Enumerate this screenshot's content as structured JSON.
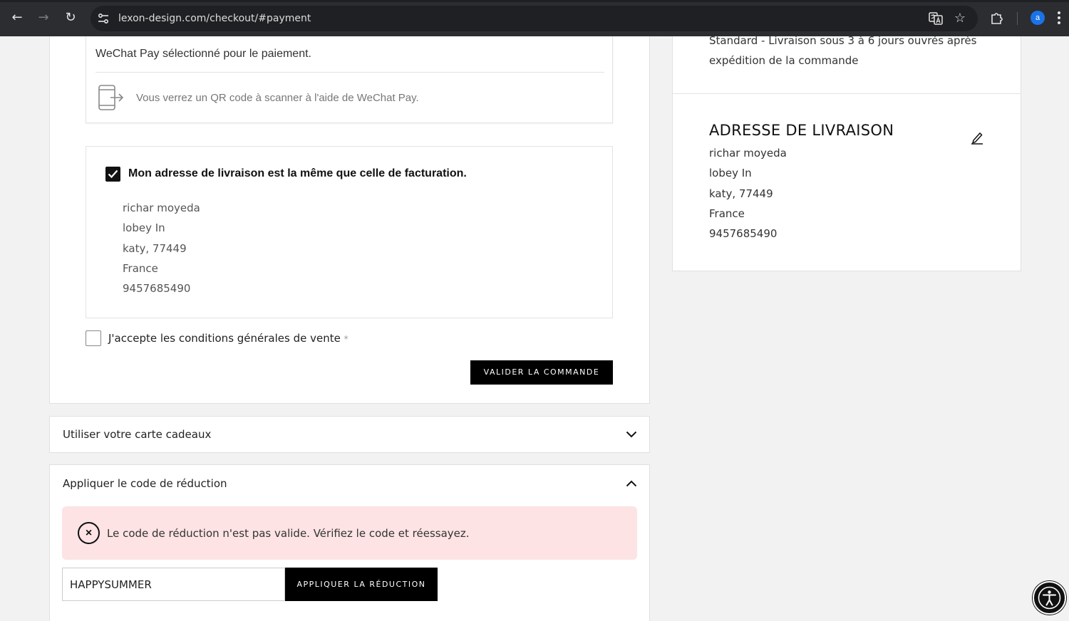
{
  "browser": {
    "url": "lexon-design.com/checkout/#payment",
    "profile_initial": "a",
    "back_glyph": "←",
    "forward_glyph": "→",
    "reload_glyph": "↻",
    "star_glyph": "☆"
  },
  "payment": {
    "selected_text": "WeChat Pay sélectionné pour le paiement.",
    "qr_text": "Vous verrez un QR code à scanner à l'aide de WeChat Pay."
  },
  "billing": {
    "same_address_label": "Mon adresse de livraison est la même que celle de facturation.",
    "address": [
      "richar moyeda",
      "lobey In",
      "katy, 77449",
      "France",
      "9457685490"
    ]
  },
  "terms": {
    "label": "J'accepte les conditions générales de vente",
    "required_mark": "*"
  },
  "validate_label": "VALIDER LA COMMANDE",
  "gift_card": {
    "title": "Utiliser votre carte cadeaux"
  },
  "discount": {
    "title": "Appliquer le code de réduction",
    "error_icon_glyph": "×",
    "error_message": "Le code de réduction n'est pas valide. Vérifiez le code et réessayez.",
    "code_value": "HAPPYSUMMER",
    "apply_label": "APPLIQUER LA RÉDUCTION"
  },
  "sidebar": {
    "shipping_method": "Standard - Livraison sous 3 à 6 jours ouvrés après expédition de la commande",
    "shipping_title": "ADRESSE DE LIVRAISON",
    "address": [
      "richar moyeda",
      "lobey In",
      "katy, 77449",
      "France",
      "9457685490"
    ]
  }
}
